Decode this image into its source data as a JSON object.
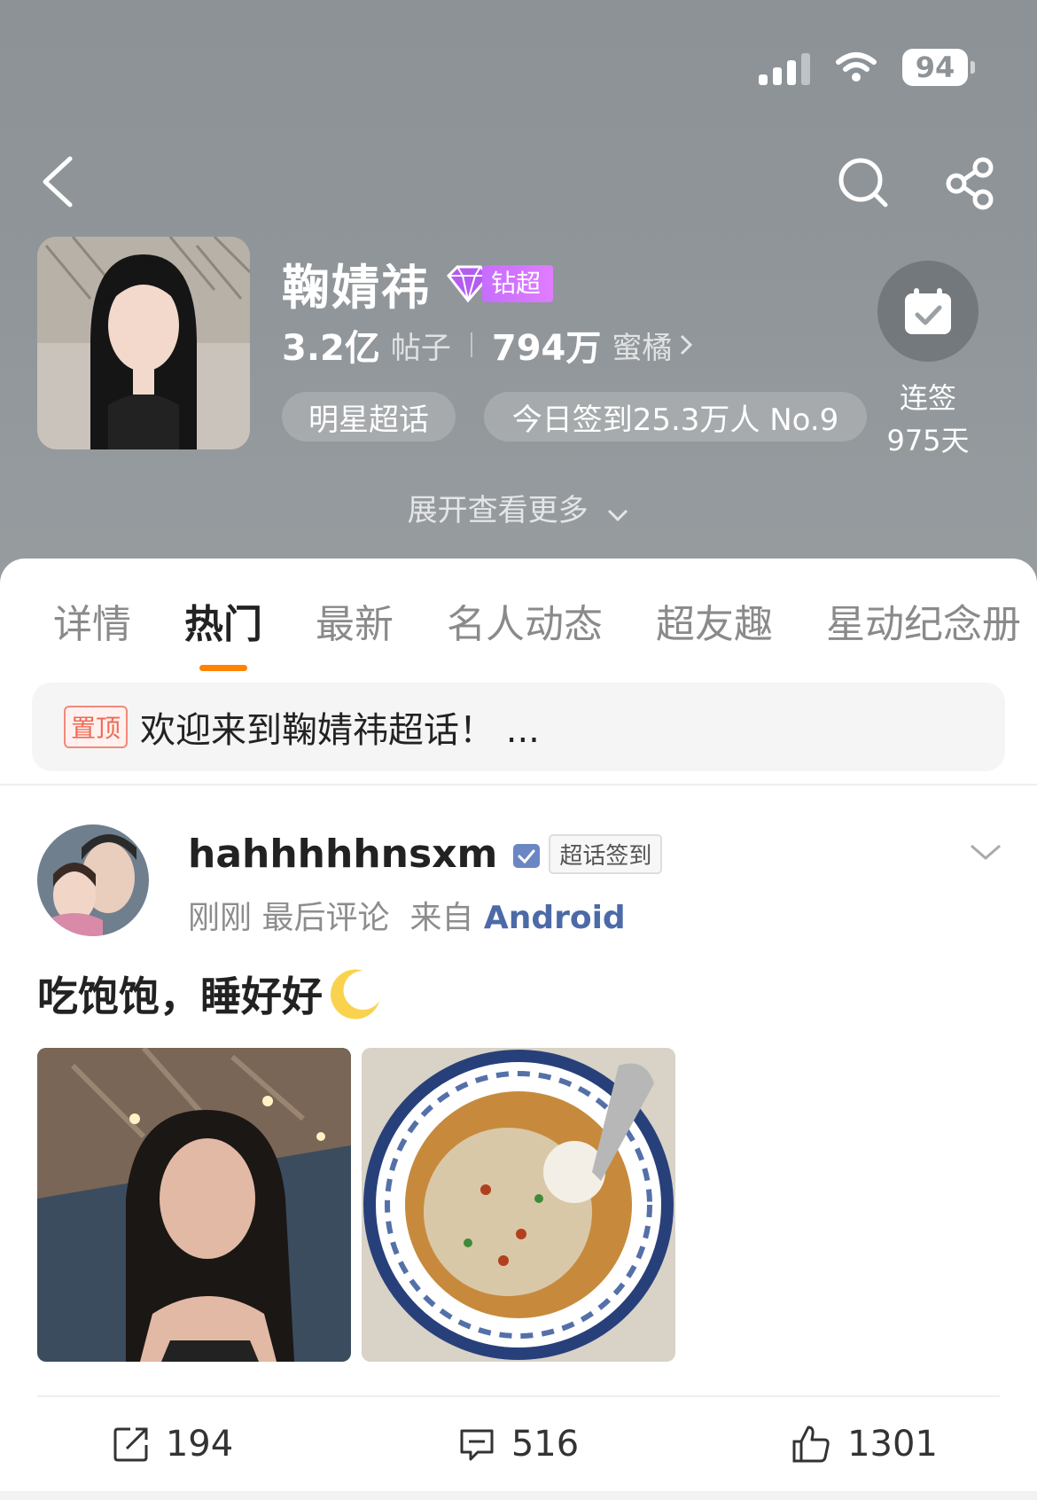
{
  "status_bar": {
    "battery": "94"
  },
  "topic": {
    "name": "鞠婧祎",
    "badge": "钻超",
    "posts_count": "3.2亿",
    "posts_label": "帖子",
    "fans_count": "794万",
    "fans_label": "蜜橘",
    "category_pill": "明星超话",
    "checkin_pill": "今日签到25.3万人 No.9",
    "checkin_label": "连签",
    "checkin_days": "975天",
    "expand_label": "展开查看更多"
  },
  "tabs": [
    {
      "label": "详情"
    },
    {
      "label": "热门"
    },
    {
      "label": "最新"
    },
    {
      "label": "名人动态"
    },
    {
      "label": "超友趣"
    },
    {
      "label": "星动纪念册"
    }
  ],
  "active_tab": "热门",
  "pinned": {
    "tag": "置顶",
    "text": "欢迎来到鞠婧祎超话！ ..."
  },
  "post": {
    "username": "hahhhhhnsxm",
    "checkin_tag": "超话签到",
    "time": "刚刚",
    "meta_label": "最后评论",
    "from_label": "来自",
    "source": "Android",
    "text": "吃饱饱，睡好好",
    "repost_count": "194",
    "comment_count": "516",
    "like_count": "1301"
  },
  "colors": {
    "header_bg": "#8f9599",
    "accent": "#ff8200",
    "source_link": "#4d6aa8",
    "pin_tag": "#ee6a55"
  }
}
